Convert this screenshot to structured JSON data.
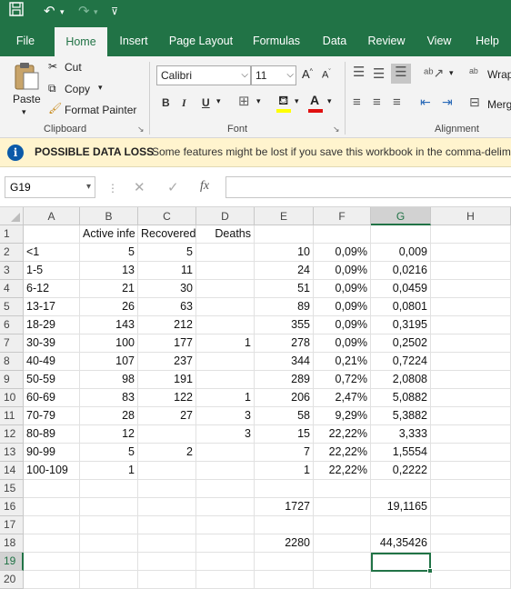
{
  "qat": {
    "save_icon": "save-icon",
    "undo_icon": "undo-icon",
    "redo_icon": "redo-icon",
    "customize_icon": "customize-qat-icon"
  },
  "tabs": [
    "File",
    "Home",
    "Insert",
    "Page Layout",
    "Formulas",
    "Data",
    "Review",
    "View",
    "Help"
  ],
  "active_tab": "Home",
  "clipboard": {
    "paste": "Paste",
    "cut": "Cut",
    "copy": "Copy",
    "format_painter": "Format Painter",
    "label": "Clipboard"
  },
  "font": {
    "name": "Calibri",
    "size": "11",
    "bold": "B",
    "italic": "I",
    "underline": "U",
    "label": "Font",
    "grow": "A",
    "shrink": "A"
  },
  "alignment": {
    "wrap": "Wrap",
    "merge": "Merg",
    "label": "Alignment"
  },
  "message_bar": {
    "title": "POSSIBLE DATA LOSS",
    "text": "Some features might be lost if you save this workbook in the comma-delim"
  },
  "formula_bar": {
    "name_box": "G19",
    "fx": "fx",
    "value": ""
  },
  "columns": [
    "A",
    "B",
    "C",
    "D",
    "E",
    "F",
    "G",
    "H"
  ],
  "selected_column": "G",
  "selected_row": "19",
  "selected_cell": "G19",
  "rows": [
    {
      "n": "1",
      "A": "",
      "B": "Active infe",
      "C": "Recovered",
      "D": "Deaths",
      "E": "",
      "F": "",
      "G": ""
    },
    {
      "n": "2",
      "A": "<1",
      "B": "5",
      "C": "5",
      "D": "",
      "E": "10",
      "F": "0,09%",
      "G": "0,009"
    },
    {
      "n": "3",
      "A": " 1-5",
      "B": "13",
      "C": "11",
      "D": "",
      "E": "24",
      "F": "0,09%",
      "G": "0,0216"
    },
    {
      "n": "4",
      "A": " 6-12",
      "B": "21",
      "C": "30",
      "D": "",
      "E": "51",
      "F": "0,09%",
      "G": "0,0459"
    },
    {
      "n": "5",
      "A": "13-17",
      "B": "26",
      "C": "63",
      "D": "",
      "E": "89",
      "F": "0,09%",
      "G": "0,0801"
    },
    {
      "n": "6",
      "A": "18-29",
      "B": "143",
      "C": "212",
      "D": "",
      "E": "355",
      "F": "0,09%",
      "G": "0,3195"
    },
    {
      "n": "7",
      "A": "30-39",
      "B": "100",
      "C": "177",
      "D": "1",
      "E": "278",
      "F": "0,09%",
      "G": "0,2502"
    },
    {
      "n": "8",
      "A": "40-49",
      "B": "107",
      "C": "237",
      "D": "",
      "E": "344",
      "F": "0,21%",
      "G": "0,7224"
    },
    {
      "n": "9",
      "A": "50-59",
      "B": "98",
      "C": "191",
      "D": "",
      "E": "289",
      "F": "0,72%",
      "G": "2,0808"
    },
    {
      "n": "10",
      "A": "60-69",
      "B": "83",
      "C": "122",
      "D": "1",
      "E": "206",
      "F": "2,47%",
      "G": "5,0882"
    },
    {
      "n": "11",
      "A": "70-79",
      "B": "28",
      "C": "27",
      "D": "3",
      "E": "58",
      "F": "9,29%",
      "G": "5,3882"
    },
    {
      "n": "12",
      "A": "80-89",
      "B": "12",
      "C": "",
      "D": "3",
      "E": "15",
      "F": "22,22%",
      "G": "3,333"
    },
    {
      "n": "13",
      "A": "90-99",
      "B": "5",
      "C": "2",
      "D": "",
      "E": "7",
      "F": "22,22%",
      "G": "1,5554"
    },
    {
      "n": "14",
      "A": "100-109",
      "B": "1",
      "C": "",
      "D": "",
      "E": "1",
      "F": "22,22%",
      "G": "0,2222"
    },
    {
      "n": "15",
      "A": "",
      "B": "",
      "C": "",
      "D": "",
      "E": "",
      "F": "",
      "G": ""
    },
    {
      "n": "16",
      "A": "",
      "B": "",
      "C": "",
      "D": "",
      "E": "1727",
      "F": "",
      "G": "19,1165"
    },
    {
      "n": "17",
      "A": "",
      "B": "",
      "C": "",
      "D": "",
      "E": "",
      "F": "",
      "G": ""
    },
    {
      "n": "18",
      "A": "",
      "B": "",
      "C": "",
      "D": "",
      "E": "2280",
      "F": "",
      "G": "44,35426"
    },
    {
      "n": "19",
      "A": "",
      "B": "",
      "C": "",
      "D": "",
      "E": "",
      "F": "",
      "G": ""
    },
    {
      "n": "20",
      "A": "",
      "B": "",
      "C": "",
      "D": "",
      "E": "",
      "F": "",
      "G": ""
    }
  ],
  "colors": {
    "brand": "#217346",
    "message_bar": "#fff4ce",
    "info_icon": "#0b5aa8"
  }
}
